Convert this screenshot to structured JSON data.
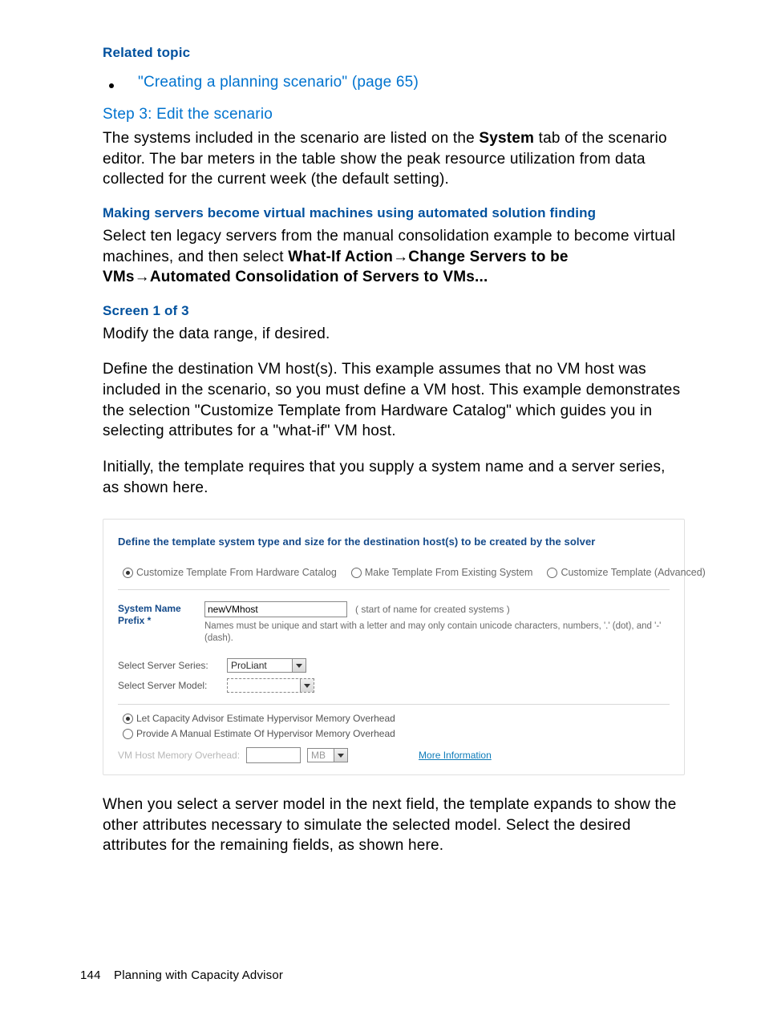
{
  "headings": {
    "related_topic": "Related topic",
    "step3": "Step 3: Edit the scenario",
    "making_servers": "Making servers become virtual machines using automated solution finding",
    "screen1": "Screen 1 of 3"
  },
  "bullet_link": "\"Creating a planning scenario\" (page 65)",
  "para1_pre": "The systems included in the scenario are listed on the ",
  "para1_bold": "System",
  "para1_post": " tab of the scenario editor. The bar meters in the table show the peak resource utilization from data collected for the current week (the default setting).",
  "para2_pre": "Select ten legacy servers from the manual consolidation example to become virtual machines, and then select ",
  "para2_b1": "What-If Action",
  "para2_b2": "Change Servers to be VMs",
  "para2_b3": "Automated Consolidation of Servers to VMs...",
  "para3": "Modify the data range, if desired.",
  "para4": "Define the destination VM host(s). This example assumes that no VM host was included in the scenario, so you must define a VM host. This example demonstrates the selection \"Customize Template from Hardware Catalog\" which guides you in selecting attributes for a \"what-if\" VM host.",
  "para5": "Initially, the template requires that you supply a system name and a server series, as shown here.",
  "dialog": {
    "title": "Define the template system type and size for the destination host(s) to be created by the solver",
    "radio1": "Customize Template From Hardware Catalog",
    "radio2": "Make Template From Existing System",
    "radio3": "Customize Template (Advanced)",
    "sysname_label": "System Name Prefix *",
    "sysname_value": "newVMhost",
    "sysname_hint_right": "( start of name for created systems )",
    "sysname_hint_below": "Names must be unique and start with a letter and may only contain unicode characters, numbers, '.' (dot), and '-' (dash).",
    "series_label": "Select Server Series:",
    "series_value": "ProLiant",
    "model_label": "Select Server Model:",
    "model_value": "",
    "mem_radio1": "Let Capacity Advisor Estimate Hypervisor Memory Overhead",
    "mem_radio2": "Provide A Manual Estimate Of Hypervisor Memory Overhead",
    "mem_label": "VM Host Memory Overhead:",
    "mem_unit": "MB",
    "more_info": "More Information"
  },
  "para6": "When you select a server model in the next field, the template expands to show the other attributes necessary to simulate the selected model. Select the desired attributes for the remaining fields, as shown here.",
  "footer": {
    "page": "144",
    "label": "Planning with Capacity Advisor"
  }
}
